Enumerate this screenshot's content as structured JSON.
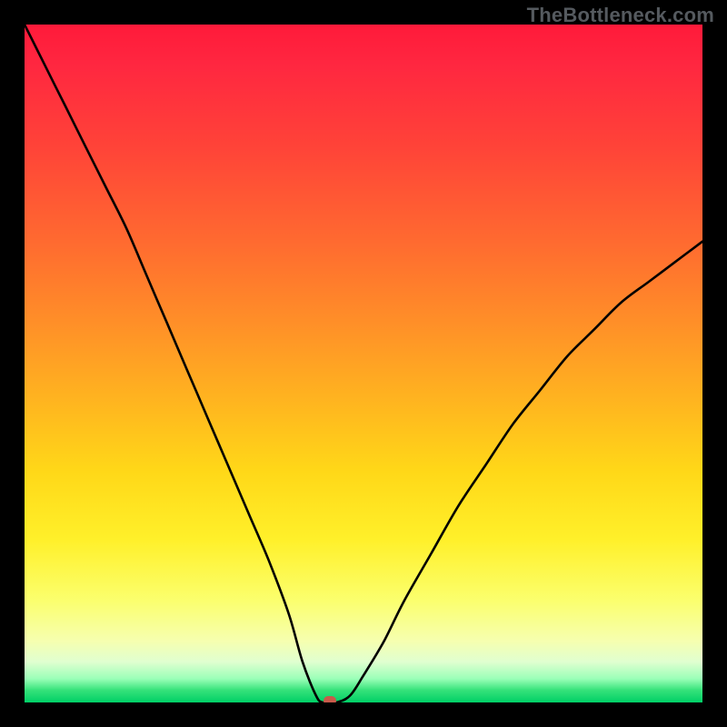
{
  "watermark": "TheBottleneck.com",
  "colors": {
    "frame": "#000000",
    "curve": "#000000",
    "marker": "#c85a4a"
  },
  "chart_data": {
    "type": "line",
    "title": "",
    "xlabel": "",
    "ylabel": "",
    "xlim": [
      0,
      100
    ],
    "ylim": [
      0,
      100
    ],
    "grid": false,
    "series": [
      {
        "name": "bottleneck-curve",
        "x": [
          0,
          3,
          6,
          9,
          12,
          15,
          18,
          21,
          24,
          27,
          30,
          33,
          36,
          39,
          41,
          43,
          44,
          46,
          48,
          50,
          53,
          56,
          60,
          64,
          68,
          72,
          76,
          80,
          84,
          88,
          92,
          96,
          100
        ],
        "values": [
          100,
          94,
          88,
          82,
          76,
          70,
          63,
          56,
          49,
          42,
          35,
          28,
          21,
          13,
          6,
          1,
          0,
          0,
          1,
          4,
          9,
          15,
          22,
          29,
          35,
          41,
          46,
          51,
          55,
          59,
          62,
          65,
          68
        ]
      }
    ],
    "marker": {
      "x": 45,
      "y": 0
    },
    "gradient_stops": [
      {
        "pct": 0,
        "color": "#ff1a3a"
      },
      {
        "pct": 50,
        "color": "#ffb61f"
      },
      {
        "pct": 85,
        "color": "#fbff6e"
      },
      {
        "pct": 100,
        "color": "#00cf66"
      }
    ]
  }
}
